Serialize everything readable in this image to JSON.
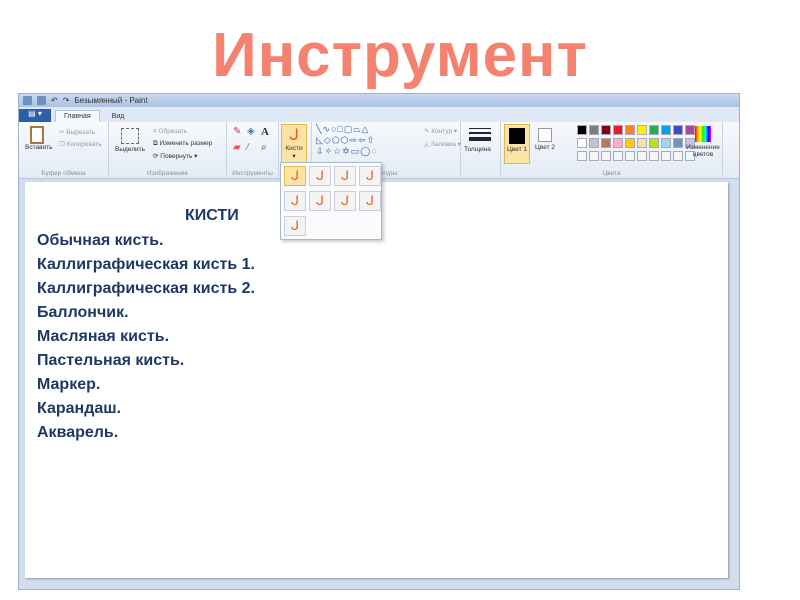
{
  "slide_title": "Инструмент",
  "window": {
    "title": "Безымянный - Paint"
  },
  "tabs": [
    "Главная",
    "Вид"
  ],
  "ribbon": {
    "clipboard": {
      "paste": "Вставить",
      "cut": "Вырезать",
      "copy": "Копировать",
      "label": "Буфер обмена"
    },
    "image": {
      "select": "Выделить",
      "crop": "Обрезать",
      "resize": "Изменить размер",
      "rotate": "Повернуть",
      "label": "Изображение"
    },
    "tools": {
      "label": "Инструменты"
    },
    "brushes": {
      "label": "Кисти"
    },
    "shapes": {
      "outline": "Контур",
      "fill": "Заливка",
      "label": "Фигуры"
    },
    "size": {
      "label": "Толщина"
    },
    "colors": {
      "color1": "Цвет 1",
      "color2": "Цвет 2",
      "edit": "Изменение цветов",
      "label": "Цвета",
      "row1": [
        "#000000",
        "#7f7f7f",
        "#880015",
        "#ed1c24",
        "#ff7f27",
        "#fff200",
        "#22b14c",
        "#00a2e8",
        "#3f48cc",
        "#a349a4"
      ],
      "row2": [
        "#ffffff",
        "#c3c3c3",
        "#b97a57",
        "#ffaec9",
        "#ffc90e",
        "#efe4b0",
        "#b5e61d",
        "#99d9ea",
        "#7092be",
        "#c8bfe7"
      ]
    }
  },
  "canvas": {
    "heading": "КИСТИ",
    "lines": [
      "Обычная кисть.",
      "Каллиграфическая кисть 1.",
      "Каллиграфическая кисть 2.",
      "Баллончик.",
      "Масляная кисть.",
      "Пастельная кисть.",
      "Маркер.",
      "Карандаш.",
      "Акварель."
    ]
  }
}
